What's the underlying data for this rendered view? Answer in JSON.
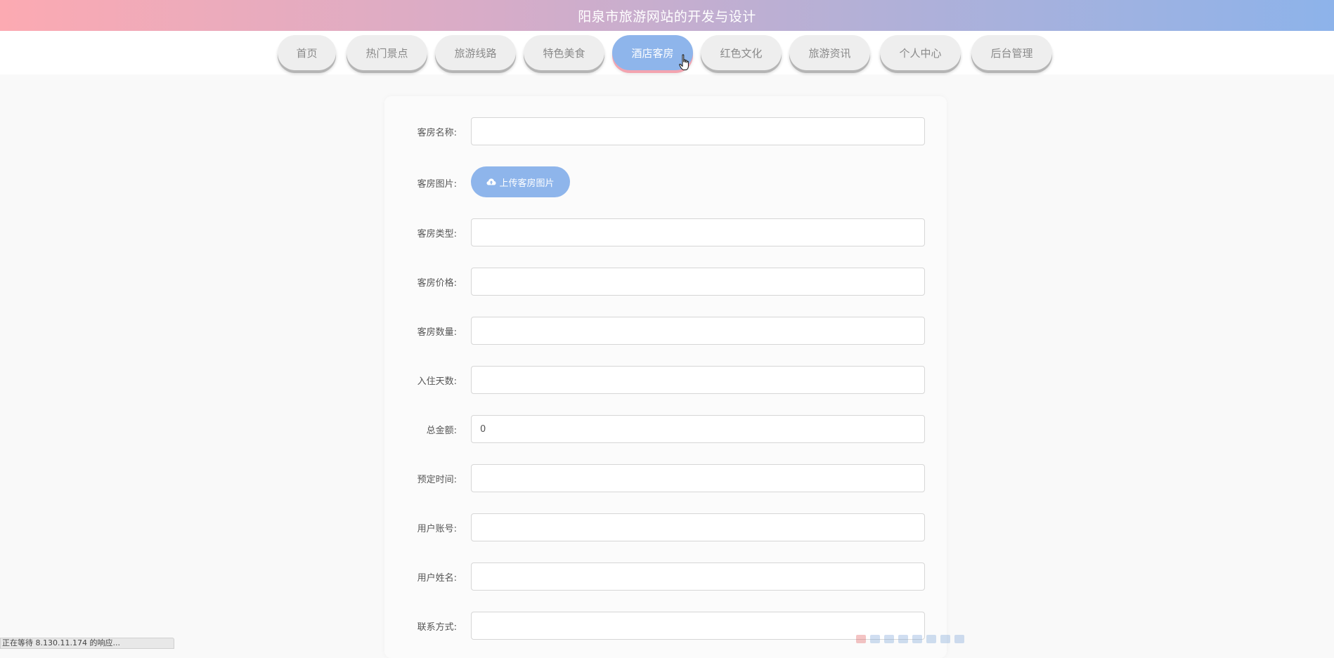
{
  "header": {
    "title": "阳泉市旅游网站的开发与设计"
  },
  "nav": {
    "items": [
      {
        "label": "首页"
      },
      {
        "label": "热门景点"
      },
      {
        "label": "旅游线路"
      },
      {
        "label": "特色美食"
      },
      {
        "label": "酒店客房"
      },
      {
        "label": "红色文化"
      },
      {
        "label": "旅游资讯"
      },
      {
        "label": "个人中心"
      },
      {
        "label": "后台管理"
      }
    ],
    "active_index": 4
  },
  "form": {
    "room_name": {
      "label": "客房名称:",
      "value": ""
    },
    "room_image": {
      "label": "客房图片:",
      "button": "上传客房图片"
    },
    "room_type": {
      "label": "客房类型:",
      "value": ""
    },
    "room_price": {
      "label": "客房价格:",
      "value": ""
    },
    "room_count": {
      "label": "客房数量:",
      "value": ""
    },
    "stay_days": {
      "label": "入住天数:",
      "value": ""
    },
    "total_amount": {
      "label": "总金额:",
      "value": "0"
    },
    "booking_time": {
      "label": "预定时间:",
      "value": ""
    },
    "user_account": {
      "label": "用户账号:",
      "value": ""
    },
    "user_name": {
      "label": "用户姓名:",
      "value": ""
    },
    "contact": {
      "label": "联系方式:",
      "value": ""
    }
  },
  "status_bar": {
    "text": "正在等待 8.130.11.174 的响应..."
  },
  "colors": {
    "accent": "#8eb5eb",
    "header_gradient_start": "#fcaab2",
    "header_gradient_end": "#8db3ea",
    "active_tab_underline": "#f3a4b0"
  }
}
